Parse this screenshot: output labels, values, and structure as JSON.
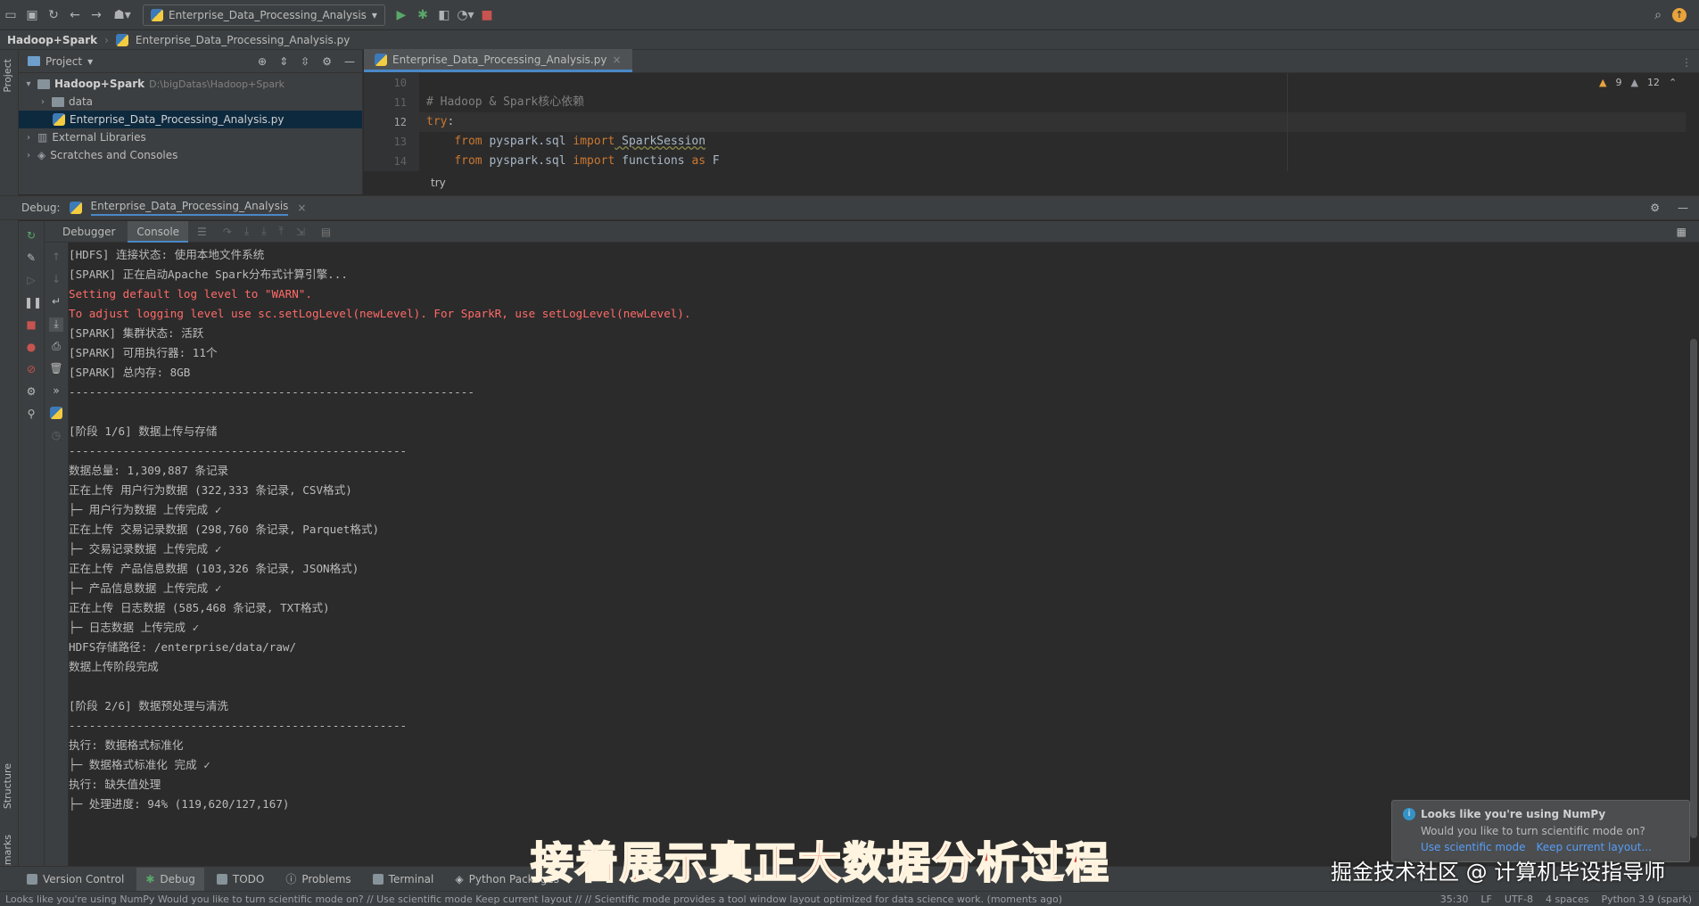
{
  "toolbar": {
    "run_config": "Enterprise_Data_Processing_Analysis",
    "icons": [
      "open-icon",
      "save-icon",
      "sync-icon",
      "back-icon",
      "forward-icon",
      "vcs-icon",
      "run-icon",
      "debug-icon",
      "coverage-icon",
      "profile-icon",
      "stop-icon",
      "search-icon",
      "update-icon"
    ]
  },
  "breadcrumb": {
    "project": "Hadoop+Spark",
    "file": "Enterprise_Data_Processing_Analysis.py"
  },
  "left_stripe": {
    "project": "Project",
    "structure": "Structure",
    "bookmarks": "Bookmarks"
  },
  "project_panel": {
    "title": "Project",
    "root_name": "Hadoop+Spark",
    "root_path": "D:\\bigDatas\\Hadoop+Spark",
    "items": [
      {
        "label": "data"
      },
      {
        "label": "Enterprise_Data_Processing_Analysis.py"
      },
      {
        "label": "External Libraries"
      },
      {
        "label": "Scratches and Consoles"
      }
    ]
  },
  "editor": {
    "tab": "Enterprise_Data_Processing_Analysis.py",
    "warnings": "9",
    "weak_warnings": "12",
    "line_numbers": [
      "10",
      "11",
      "12",
      "13",
      "14"
    ],
    "lines": {
      "l11": "# Hadoop & Spark核心依赖",
      "l12_kw": "try",
      "l12_rest": ":",
      "l13_kw1": "from",
      "l13_mod": " pyspark.sql ",
      "l13_kw2": "import",
      "l13_name": " SparkSession",
      "l14_kw1": "from",
      "l14_mod": " pyspark.sql ",
      "l14_kw2": "import",
      "l14_name": " functions ",
      "l14_kw3": "as",
      "l14_alias": " F"
    },
    "breadcrumb_hint": "try"
  },
  "debug": {
    "label": "Debug:",
    "session": "Enterprise_Data_Processing_Analysis",
    "tabs": [
      "Debugger",
      "Console"
    ]
  },
  "console": [
    {
      "text": "[HDFS] 连接状态: 使用本地文件系统",
      "red": false
    },
    {
      "text": "[SPARK] 正在启动Apache Spark分布式计算引擎...",
      "red": false
    },
    {
      "text": "Setting default log level to \"WARN\".",
      "red": true
    },
    {
      "text": "To adjust logging level use sc.setLogLevel(newLevel). For SparkR, use setLogLevel(newLevel).",
      "red": true
    },
    {
      "text": "[SPARK] 集群状态: 活跃",
      "red": false
    },
    {
      "text": "[SPARK] 可用执行器: 11个",
      "red": false
    },
    {
      "text": "[SPARK] 总内存: 8GB",
      "red": false
    },
    {
      "text": "------------------------------------------------------------",
      "red": false
    },
    {
      "text": "",
      "red": false
    },
    {
      "text": "[阶段 1/6] 数据上传与存储",
      "red": false
    },
    {
      "text": "--------------------------------------------------",
      "red": false
    },
    {
      "text": "数据总量: 1,309,887 条记录",
      "red": false
    },
    {
      "text": "正在上传 用户行为数据 (322,333 条记录, CSV格式)",
      "red": false
    },
    {
      "text": "├─ 用户行为数据 上传完成 ✓",
      "red": false
    },
    {
      "text": "正在上传 交易记录数据 (298,760 条记录, Parquet格式)",
      "red": false
    },
    {
      "text": "├─ 交易记录数据 上传完成 ✓",
      "red": false
    },
    {
      "text": "正在上传 产品信息数据 (103,326 条记录, JSON格式)",
      "red": false
    },
    {
      "text": "├─ 产品信息数据 上传完成 ✓",
      "red": false
    },
    {
      "text": "正在上传 日志数据 (585,468 条记录, TXT格式)",
      "red": false
    },
    {
      "text": "├─ 日志数据 上传完成 ✓",
      "red": false
    },
    {
      "text": "HDFS存储路径: /enterprise/data/raw/",
      "red": false
    },
    {
      "text": "数据上传阶段完成",
      "red": false
    },
    {
      "text": "",
      "red": false
    },
    {
      "text": "[阶段 2/6] 数据预处理与清洗",
      "red": false
    },
    {
      "text": "--------------------------------------------------",
      "red": false
    },
    {
      "text": "执行: 数据格式标准化",
      "red": false
    },
    {
      "text": "├─ 数据格式标准化 完成 ✓",
      "red": false
    },
    {
      "text": "执行: 缺失值处理",
      "red": false
    },
    {
      "text": "├─ 处理进度: 94% (119,620/127,167)",
      "red": false
    }
  ],
  "bottom_tabs": [
    "Version Control",
    "Debug",
    "TODO",
    "Problems",
    "Terminal",
    "Python Packages"
  ],
  "notification": {
    "title": "Looks like you're using NumPy",
    "body": "Would you like to turn scientific mode on?",
    "action1": "Use scientific mode",
    "action2": "Keep current layout..."
  },
  "statusbar": {
    "message": "Looks like you're using NumPy Would you like to turn scientific mode on? // Use scientific mode     Keep current layout // // Scientific mode provides a tool window layout optimized for data science work. (moments ago)",
    "position": "35:30",
    "line_sep": "LF",
    "encoding": "UTF-8",
    "indent": "4 spaces",
    "interpreter": "Python 3.9 (spark)"
  },
  "overlay": {
    "caption": "接着展示真正大数据分析过程",
    "watermark": "掘金技术社区 @ 计算机毕设指导师"
  },
  "colors": {
    "accent": "#4a88c7",
    "error_text": "#ff6b68",
    "caption": "#d9342b"
  }
}
